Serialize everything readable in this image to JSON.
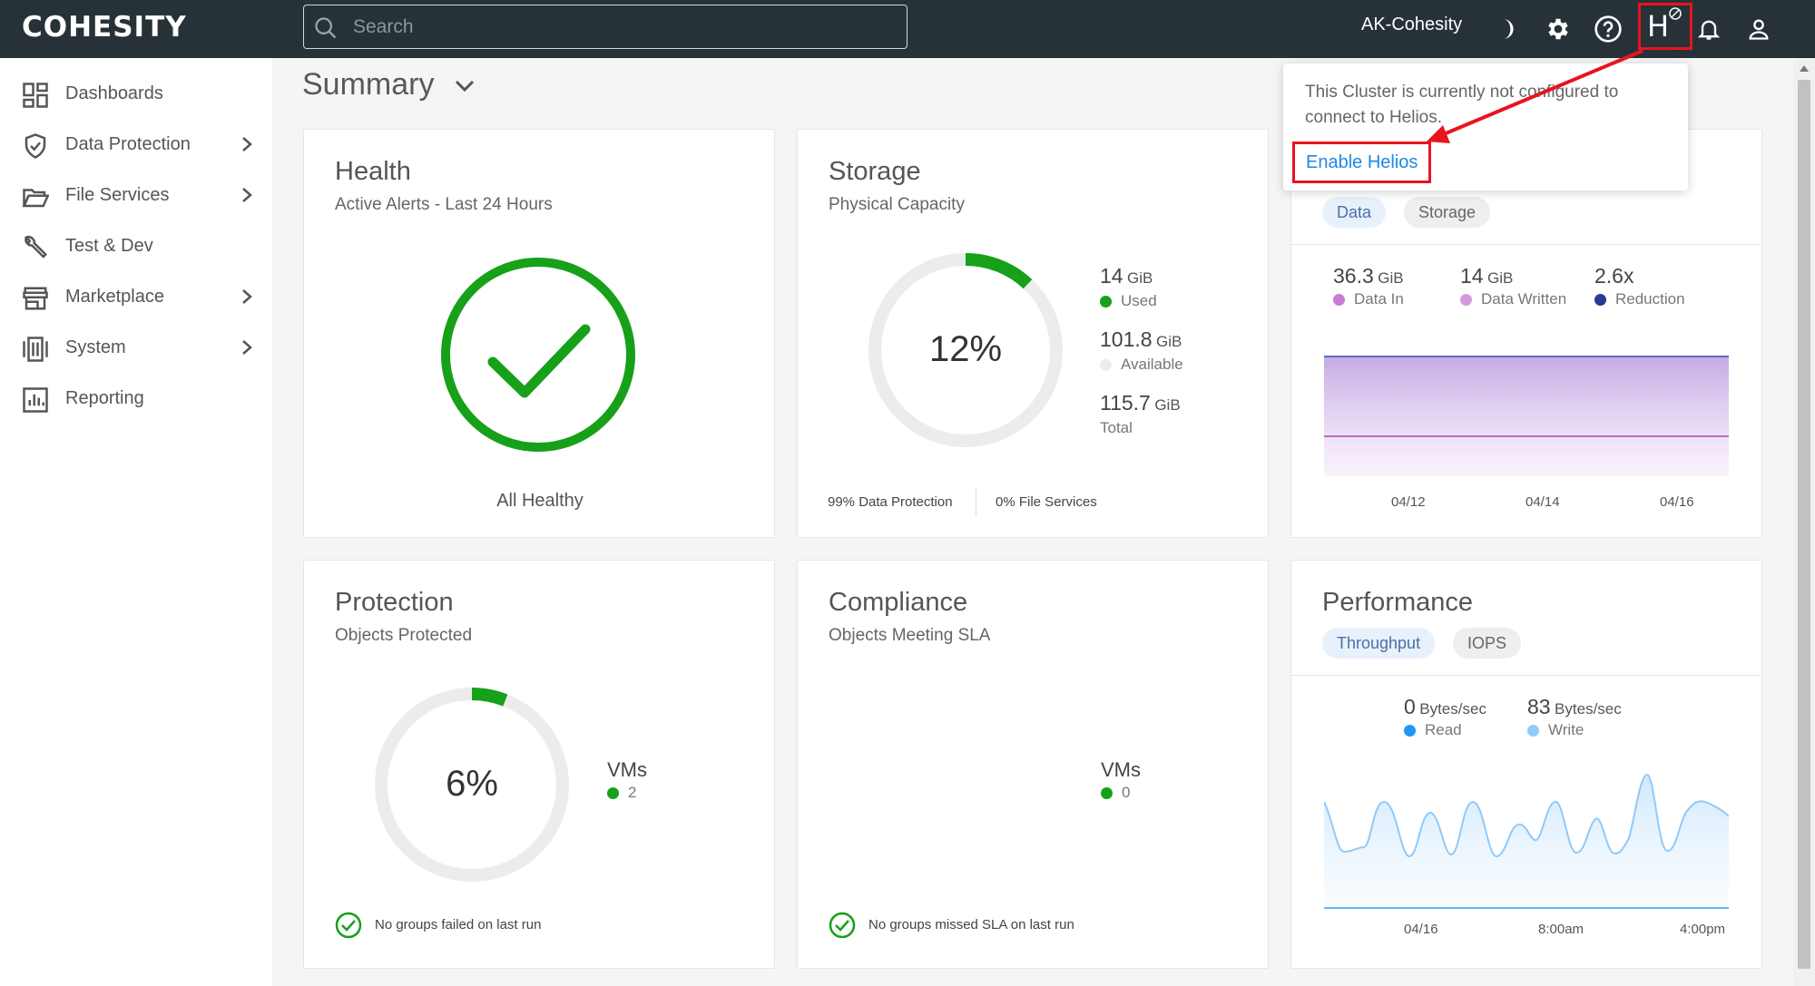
{
  "app": {
    "logo": "COHESITY",
    "cluster_name": "AK-Cohesity"
  },
  "search": {
    "placeholder": "Search"
  },
  "header_icons": [
    "moon-icon",
    "gear-icon",
    "help-icon",
    "helios-icon",
    "bell-icon",
    "user-icon"
  ],
  "helios": {
    "label": "H"
  },
  "sidebar": {
    "items": [
      {
        "label": "Dashboards",
        "icon": "dashboard-icon",
        "has_children": false
      },
      {
        "label": "Data Protection",
        "icon": "shield-icon",
        "has_children": true
      },
      {
        "label": "File Services",
        "icon": "folder-icon",
        "has_children": true
      },
      {
        "label": "Test & Dev",
        "icon": "wrench-icon",
        "has_children": false
      },
      {
        "label": "Marketplace",
        "icon": "store-icon",
        "has_children": true
      },
      {
        "label": "System",
        "icon": "server-icon",
        "has_children": true
      },
      {
        "label": "Reporting",
        "icon": "chart-icon",
        "has_children": false
      }
    ]
  },
  "page": {
    "title": "Summary"
  },
  "health": {
    "title": "Health",
    "subtitle": "Active Alerts - Last 24 Hours",
    "status": "All Healthy"
  },
  "storage": {
    "title": "Storage",
    "subtitle": "Physical Capacity",
    "percent": "12%",
    "percent_value": 12,
    "used_value": "14",
    "used_unit": "GiB",
    "used_label": "Used",
    "available_value": "101.8",
    "available_unit": "GiB",
    "available_label": "Available",
    "total_value": "115.7",
    "total_unit": "GiB",
    "total_label": "Total",
    "footer_left": "99% Data Protection",
    "footer_right": "0% File Services"
  },
  "reduction": {
    "tab_data": "Data",
    "tab_storage": "Storage",
    "data_in_value": "36.3",
    "data_in_unit": "GiB",
    "data_in_label": "Data In",
    "written_value": "14",
    "written_unit": "GiB",
    "written_label": "Data Written",
    "reduction_value": "2.6x",
    "reduction_label": "Reduction",
    "x_labels": [
      "04/12",
      "04/14",
      "04/16"
    ]
  },
  "protection": {
    "title": "Protection",
    "subtitle": "Objects Protected",
    "percent": "6%",
    "percent_value": 6,
    "vms_label": "VMs",
    "vms_count": "2",
    "footer": "No groups failed on last run"
  },
  "compliance": {
    "title": "Compliance",
    "subtitle": "Objects Meeting SLA",
    "vms_label": "VMs",
    "vms_count": "0",
    "footer": "No groups missed SLA on last run"
  },
  "performance": {
    "title": "Performance",
    "tab_throughput": "Throughput",
    "tab_iops": "IOPS",
    "read_value": "0",
    "read_unit": "Bytes/sec",
    "read_label": "Read",
    "write_value": "83",
    "write_unit": "Bytes/sec",
    "write_label": "Write",
    "x_labels": [
      "04/16",
      "8:00am",
      "4:00pm"
    ]
  },
  "popover": {
    "text": "This Cluster is currently not configured to connect to Helios.",
    "link": "Enable Helios"
  },
  "colors": {
    "topbar": "#263238",
    "green": "#17a019",
    "purple": "#c77bd6",
    "navy": "#2a3b8f",
    "blue": "#1e88e5",
    "light_blue": "#90caf9",
    "annotation_red": "#e8141f"
  }
}
